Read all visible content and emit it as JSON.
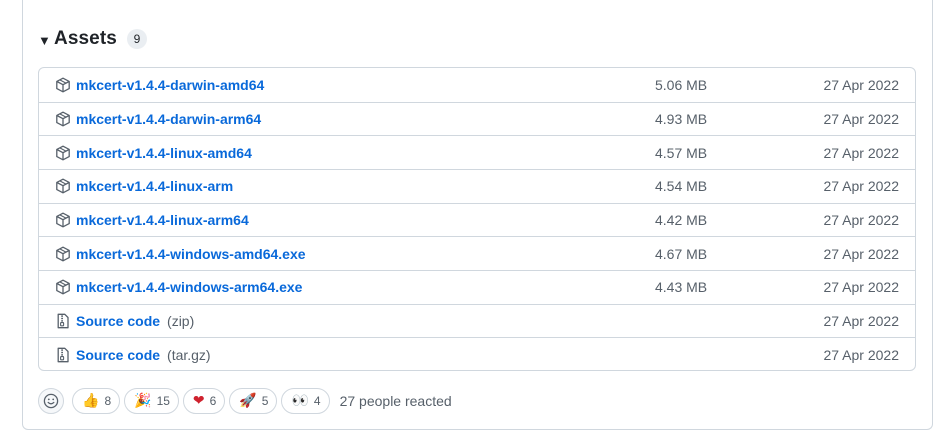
{
  "assets": {
    "title": "Assets",
    "count": "9",
    "items": [
      {
        "name": "mkcert-v1.4.4-darwin-amd64",
        "ext": "",
        "size": "5.06 MB",
        "date": "27 Apr 2022",
        "icon": "package-icon"
      },
      {
        "name": "mkcert-v1.4.4-darwin-arm64",
        "ext": "",
        "size": "4.93 MB",
        "date": "27 Apr 2022",
        "icon": "package-icon"
      },
      {
        "name": "mkcert-v1.4.4-linux-amd64",
        "ext": "",
        "size": "4.57 MB",
        "date": "27 Apr 2022",
        "icon": "package-icon"
      },
      {
        "name": "mkcert-v1.4.4-linux-arm",
        "ext": "",
        "size": "4.54 MB",
        "date": "27 Apr 2022",
        "icon": "package-icon"
      },
      {
        "name": "mkcert-v1.4.4-linux-arm64",
        "ext": "",
        "size": "4.42 MB",
        "date": "27 Apr 2022",
        "icon": "package-icon"
      },
      {
        "name": "mkcert-v1.4.4-windows-amd64.exe",
        "ext": "",
        "size": "4.67 MB",
        "date": "27 Apr 2022",
        "icon": "package-icon"
      },
      {
        "name": "mkcert-v1.4.4-windows-arm64.exe",
        "ext": "",
        "size": "4.43 MB",
        "date": "27 Apr 2022",
        "icon": "package-icon"
      },
      {
        "name": "Source code",
        "ext": "(zip)",
        "size": "",
        "date": "27 Apr 2022",
        "icon": "file-zip-icon"
      },
      {
        "name": "Source code",
        "ext": "(tar.gz)",
        "size": "",
        "date": "27 Apr 2022",
        "icon": "file-zip-icon"
      }
    ]
  },
  "reactions": {
    "items": [
      {
        "emoji": "👍",
        "count": "8",
        "icon": "thumbs-up-icon"
      },
      {
        "emoji": "🎉",
        "count": "15",
        "icon": "party-popper-icon"
      },
      {
        "emoji": "❤",
        "count": "6",
        "icon": "heart-icon"
      },
      {
        "emoji": "🚀",
        "count": "5",
        "icon": "rocket-icon"
      },
      {
        "emoji": "👀",
        "count": "4",
        "icon": "eyes-icon"
      }
    ],
    "summary": "27 people reacted"
  },
  "colors": {
    "link": "#0969da",
    "muted": "#57606a",
    "border": "#d0d7de",
    "heart": "#cf222e"
  }
}
